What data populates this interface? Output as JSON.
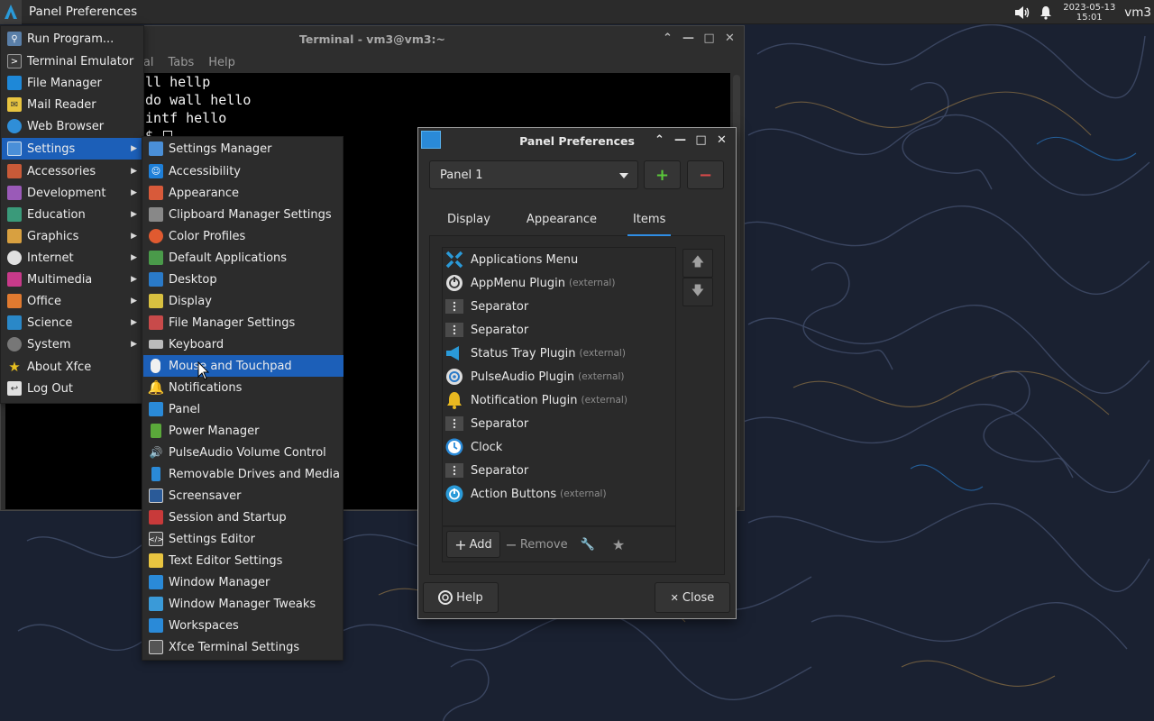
{
  "panel": {
    "task_title": "Panel Preferences",
    "clock_date": "2023-05-13",
    "clock_time": "15:01",
    "user": "vm3"
  },
  "terminal": {
    "title": "Terminal - vm3@vm3:~",
    "menu": [
      "inal",
      "Tabs",
      "Help"
    ],
    "lines": [
      "ll hellp",
      "do wall hello",
      "intf hello",
      "$ "
    ]
  },
  "app_menu": {
    "items": [
      {
        "label": "Run Program...",
        "icon": "run-program-icon",
        "color": "#5a7fa8"
      },
      {
        "label": "Terminal Emulator",
        "icon": "terminal-icon",
        "color": "#3a3a3a"
      },
      {
        "label": "File Manager",
        "icon": "file-manager-icon",
        "color": "#1e88d8"
      },
      {
        "label": "Mail Reader",
        "icon": "mail-icon",
        "color": "#e8c440"
      },
      {
        "label": "Web Browser",
        "icon": "web-browser-icon",
        "color": "#2f8ed8"
      },
      {
        "label": "Settings",
        "icon": "settings-icon",
        "color": "#4a8fd8"
      },
      {
        "label": "Accessories",
        "icon": "accessories-icon",
        "color": "#c85a38"
      },
      {
        "label": "Development",
        "icon": "development-icon",
        "color": "#9a5ab8"
      },
      {
        "label": "Education",
        "icon": "education-icon",
        "color": "#3a9a7a"
      },
      {
        "label": "Graphics",
        "icon": "graphics-icon",
        "color": "#d8a040"
      },
      {
        "label": "Internet",
        "icon": "internet-icon",
        "color": "#e0e0e0"
      },
      {
        "label": "Multimedia",
        "icon": "multimedia-icon",
        "color": "#c83a8a"
      },
      {
        "label": "Office",
        "icon": "office-icon",
        "color": "#e07a30"
      },
      {
        "label": "Science",
        "icon": "science-icon",
        "color": "#2a88c8"
      },
      {
        "label": "System",
        "icon": "system-icon",
        "color": "#777777"
      },
      {
        "label": "About Xfce",
        "icon": "about-xfce-icon",
        "color": "#e8c020"
      },
      {
        "label": "Log Out",
        "icon": "log-out-icon",
        "color": "#e0e0e0"
      }
    ]
  },
  "settings_menu": {
    "items": [
      {
        "label": "Settings Manager",
        "icon": "settings-manager-icon",
        "color": "#4a8fd8"
      },
      {
        "label": "Accessibility",
        "icon": "accessibility-icon",
        "color": "#1e7fd8"
      },
      {
        "label": "Appearance",
        "icon": "appearance-icon",
        "color": "#d85a3a"
      },
      {
        "label": "Clipboard Manager Settings",
        "icon": "clipboard-icon",
        "color": "#888888"
      },
      {
        "label": "Color Profiles",
        "icon": "color-profiles-icon",
        "color": "#e05a30"
      },
      {
        "label": "Default Applications",
        "icon": "default-applications-icon",
        "color": "#4a9a4a"
      },
      {
        "label": "Desktop",
        "icon": "desktop-icon",
        "color": "#2a7ac8"
      },
      {
        "label": "Display",
        "icon": "display-icon",
        "color": "#d8c040"
      },
      {
        "label": "File Manager Settings",
        "icon": "file-manager-settings-icon",
        "color": "#c84a4a"
      },
      {
        "label": "Keyboard",
        "icon": "keyboard-icon",
        "color": "#bbbbbb"
      },
      {
        "label": "Mouse and Touchpad",
        "icon": "mouse-icon",
        "color": "#f0f0f0"
      },
      {
        "label": "Notifications",
        "icon": "notifications-icon",
        "color": "#e8b820"
      },
      {
        "label": "Panel",
        "icon": "panel-icon",
        "color": "#2a8ad8"
      },
      {
        "label": "Power Manager",
        "icon": "power-manager-icon",
        "color": "#5aa83a"
      },
      {
        "label": "PulseAudio Volume Control",
        "icon": "volume-icon",
        "color": "#e0e0e0"
      },
      {
        "label": "Removable Drives and Media",
        "icon": "removable-drives-icon",
        "color": "#2a8ad8"
      },
      {
        "label": "Screensaver",
        "icon": "screensaver-icon",
        "color": "#2a5a98"
      },
      {
        "label": "Session and Startup",
        "icon": "session-icon",
        "color": "#c83a3a"
      },
      {
        "label": "Settings Editor",
        "icon": "settings-editor-icon",
        "color": "#444444"
      },
      {
        "label": "Text Editor Settings",
        "icon": "text-editor-icon",
        "color": "#e8c440"
      },
      {
        "label": "Window Manager",
        "icon": "window-manager-icon",
        "color": "#2a8ad8"
      },
      {
        "label": "Window Manager Tweaks",
        "icon": "window-manager-tweaks-icon",
        "color": "#3a9ad8"
      },
      {
        "label": "Workspaces",
        "icon": "workspaces-icon",
        "color": "#2a8ad8"
      },
      {
        "label": "Xfce Terminal Settings",
        "icon": "xfce-terminal-settings-icon",
        "color": "#555555"
      }
    ]
  },
  "prefs": {
    "title": "Panel Preferences",
    "panel_select": "Panel 1",
    "add_symbol": "+",
    "remove_symbol": "−",
    "tabs": [
      "Display",
      "Appearance",
      "Items"
    ],
    "items": [
      {
        "label": "Applications Menu",
        "ext": "",
        "icon": "applications-menu-icon"
      },
      {
        "label": "AppMenu Plugin",
        "ext": "(external)",
        "icon": "appmenu-plugin-icon"
      },
      {
        "label": "Separator",
        "ext": "",
        "icon": "separator-icon"
      },
      {
        "label": "Separator",
        "ext": "",
        "icon": "separator-icon"
      },
      {
        "label": "Status Tray Plugin",
        "ext": "(external)",
        "icon": "status-tray-icon"
      },
      {
        "label": "PulseAudio Plugin",
        "ext": "(external)",
        "icon": "pulseaudio-plugin-icon"
      },
      {
        "label": "Notification Plugin",
        "ext": "(external)",
        "icon": "notification-plugin-icon"
      },
      {
        "label": "Separator",
        "ext": "",
        "icon": "separator-icon"
      },
      {
        "label": "Clock",
        "ext": "",
        "icon": "clock-icon"
      },
      {
        "label": "Separator",
        "ext": "",
        "icon": "separator-icon"
      },
      {
        "label": "Action Buttons",
        "ext": "(external)",
        "icon": "action-buttons-icon"
      }
    ],
    "add_label": "Add",
    "remove_label": "Remove",
    "help_label": "Help",
    "close_label": "Close"
  },
  "colors": {
    "accent": "#2f8de4",
    "menu_selection": "#1c5fb8",
    "add_green": "#5ac83a",
    "remove_red": "#d84a4a"
  }
}
